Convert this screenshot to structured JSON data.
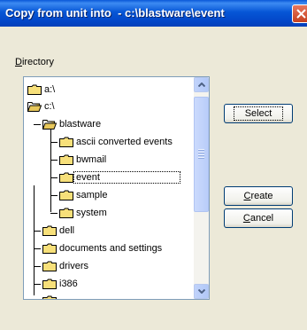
{
  "window": {
    "title": "Copy from unit into  - c:\\blastware\\event"
  },
  "directory_label": {
    "accel": "D",
    "rest": "irectory"
  },
  "tree": [
    {
      "label": "a:\\",
      "icon": "folder-closed-icon"
    },
    {
      "label": "c:\\",
      "icon": "folder-open-icon"
    },
    {
      "label": "blastware",
      "icon": "folder-open-icon"
    },
    {
      "label": "ascii converted events",
      "icon": "folder-closed-icon"
    },
    {
      "label": "bwmail",
      "icon": "folder-closed-icon"
    },
    {
      "label": "event",
      "icon": "folder-closed-icon",
      "selected": true
    },
    {
      "label": "sample",
      "icon": "folder-closed-icon"
    },
    {
      "label": "system",
      "icon": "folder-closed-icon"
    },
    {
      "label": "dell",
      "icon": "folder-closed-icon"
    },
    {
      "label": "documents and settings",
      "icon": "folder-closed-icon"
    },
    {
      "label": "drivers",
      "icon": "folder-closed-icon"
    },
    {
      "label": "i386",
      "icon": "folder-closed-icon"
    }
  ],
  "buttons": {
    "select": {
      "accel": "",
      "rest": "Select"
    },
    "create": {
      "accel": "C",
      "rest": "reate"
    },
    "cancel": {
      "accel": "C",
      "rest": "ancel"
    }
  }
}
